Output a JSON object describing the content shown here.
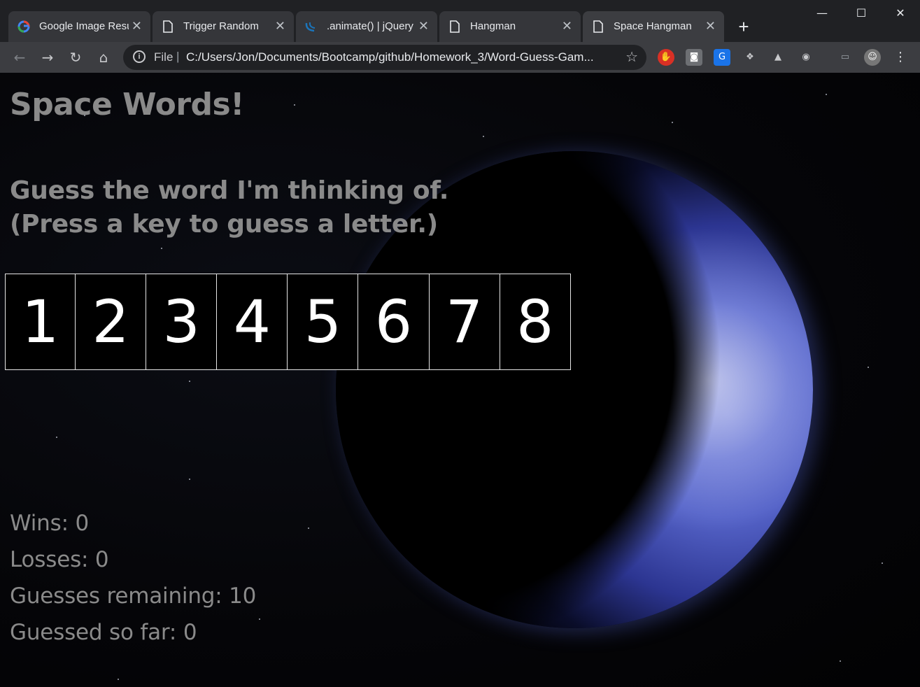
{
  "browser": {
    "tabs": [
      {
        "title": "Google Image Resu",
        "icon": "google-icon"
      },
      {
        "title": "Trigger Random",
        "icon": "page-icon"
      },
      {
        "title": ".animate() | jQuery",
        "icon": "jquery-icon"
      },
      {
        "title": "Hangman",
        "icon": "page-icon"
      },
      {
        "title": "Space Hangman",
        "icon": "page-icon",
        "active": true
      }
    ],
    "address": {
      "scheme": "File",
      "url": "C:/Users/Jon/Documents/Bootcamp/github/Homework_3/Word-Guess-Gam..."
    }
  },
  "game": {
    "title": "Space Words!",
    "instruction_line1": "Guess the word I'm thinking of.",
    "instruction_line2": "(Press a key to guess a letter.)",
    "slots": [
      "1",
      "2",
      "3",
      "4",
      "5",
      "6",
      "7",
      "8"
    ],
    "wins": "Wins: 0",
    "losses": "Losses: 0",
    "guesses_remaining": "Guesses remaining: 10",
    "guessed_so_far": "Guessed so far: 0"
  },
  "colors": {
    "heading_text": "#8a8a8a",
    "slot_text": "#ffffff",
    "slot_border": "#e6e6e6",
    "planet_blue": "#5563c8"
  }
}
